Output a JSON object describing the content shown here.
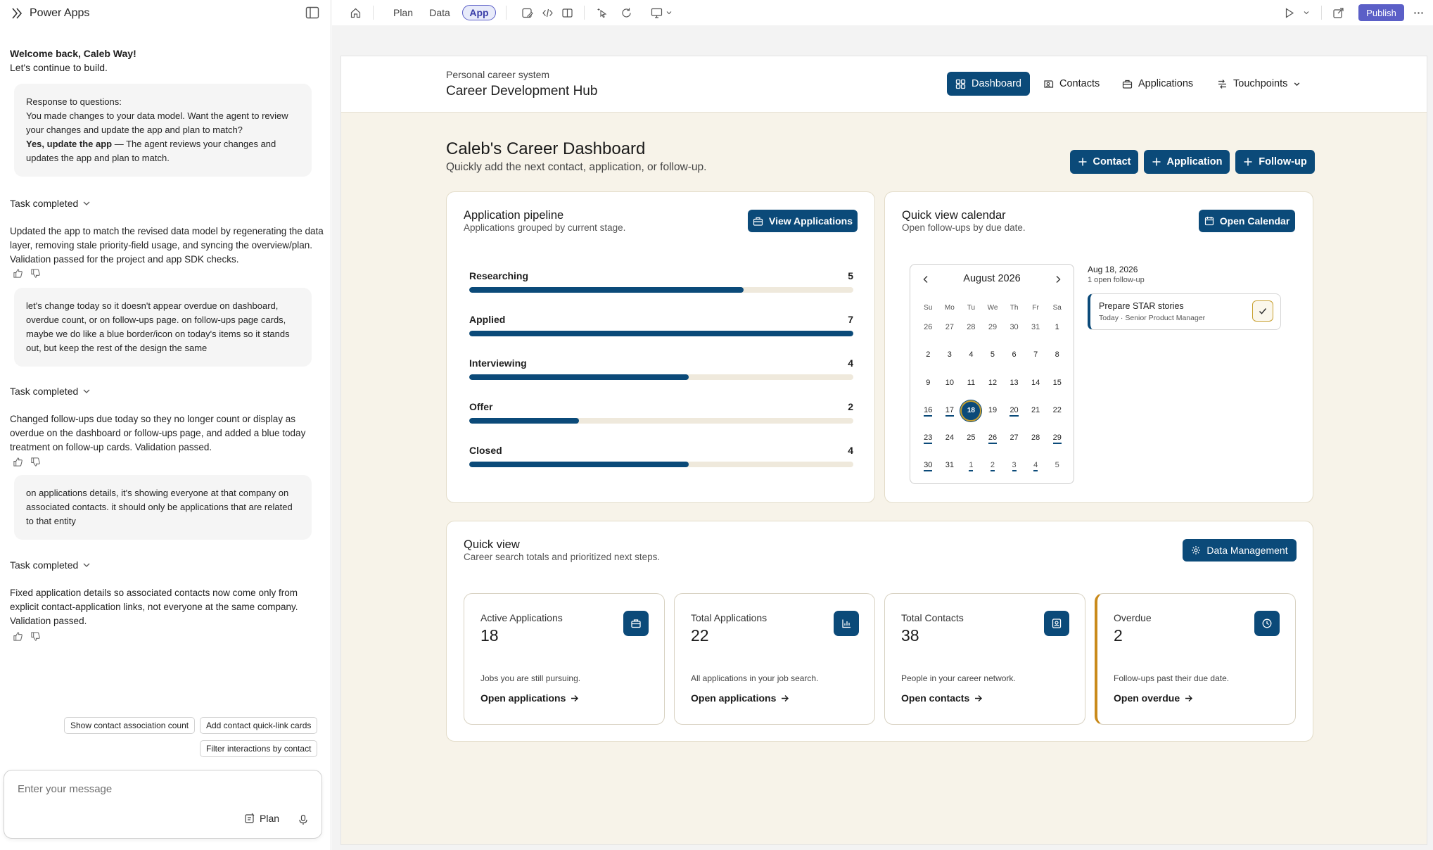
{
  "left_panel": {
    "brand": "Power Apps",
    "welcome_line1": "Welcome back, Caleb Way!",
    "welcome_line2": "Let's continue to build.",
    "response_bubble": {
      "heading": "Response to questions:",
      "body": "You made changes to your data model. Want the agent to review your changes and update the app and plan to match?",
      "choice_bold": "Yes, update the app",
      "choice_rest": " — The agent reviews your changes and updates the app and plan to match."
    },
    "task_completed_label": "Task completed",
    "messages": [
      "Updated the app to match the revised data model by regenerating the data layer, removing stale priority-field usage, and syncing the overview/plan. Validation passed for the project and app SDK checks.",
      "Changed follow-ups due today so they no longer count or display as overdue on the dashboard or follow-ups page, and added a blue today treatment on follow-up cards. Validation passed.",
      "Fixed application details so associated contacts now come only from explicit contact-application links, not everyone at the same company. Validation passed."
    ],
    "user_messages": [
      "let's change today so it doesn't appear overdue on dashboard, overdue count, or on follow-ups page. on follow-ups page cards, maybe we do like a blue border/icon on today's items so it stands out, but keep the rest of the design the same",
      "on applications details, it's showing everyone at that company on associated contacts. it should only be applications that are related to that entity"
    ],
    "suggestions": [
      "Show contact association count",
      "Add contact quick-link cards",
      "Filter interactions by contact"
    ],
    "composer_placeholder": "Enter your message",
    "plan_label": "Plan"
  },
  "topbar": {
    "tabs": [
      "Plan",
      "Data",
      "App"
    ],
    "active_tab": "App",
    "publish_label": "Publish"
  },
  "app": {
    "subtitle": "Personal career system",
    "title": "Career Development Hub",
    "nav": [
      "Dashboard",
      "Contacts",
      "Applications",
      "Touchpoints"
    ],
    "active_nav": "Dashboard",
    "dashboard_title": "Caleb's Career Dashboard",
    "dashboard_subtitle": "Quickly add the next contact, application, or follow-up.",
    "quick_add": [
      "Contact",
      "Application",
      "Follow-up"
    ]
  },
  "pipeline": {
    "title": "Application pipeline",
    "subtitle": "Applications grouped by current stage.",
    "button": "View Applications",
    "max": 7,
    "stages": [
      {
        "label": "Researching",
        "value": 5
      },
      {
        "label": "Applied",
        "value": 7
      },
      {
        "label": "Interviewing",
        "value": 4
      },
      {
        "label": "Offer",
        "value": 2
      },
      {
        "label": "Closed",
        "value": 4
      }
    ]
  },
  "calendar": {
    "title": "Quick view calendar",
    "subtitle": "Open follow-ups by due date.",
    "button": "Open Calendar",
    "month_label": "August 2026",
    "dow": [
      "Su",
      "Mo",
      "Tu",
      "We",
      "Th",
      "Fr",
      "Sa"
    ],
    "days": [
      [
        "26",
        "27",
        "28",
        "29",
        "30",
        "31",
        "1"
      ],
      [
        "2",
        "3",
        "4",
        "5",
        "6",
        "7",
        "8"
      ],
      [
        "9",
        "10",
        "11",
        "12",
        "13",
        "14",
        "15"
      ],
      [
        "16",
        "17",
        "18",
        "19",
        "20",
        "21",
        "22"
      ],
      [
        "23",
        "24",
        "25",
        "26",
        "27",
        "28",
        "29"
      ],
      [
        "30",
        "31",
        "1",
        "2",
        "3",
        "4",
        "5"
      ]
    ],
    "today": "18",
    "selected_date": "Aug 18, 2026",
    "open_count": "1 open follow-up",
    "followup_title": "Prepare STAR stories",
    "followup_sub": "Today · Senior Product Manager"
  },
  "quick_view": {
    "title": "Quick view",
    "subtitle": "Career search totals and prioritized next steps.",
    "button": "Data Management",
    "stats": [
      {
        "label": "Active Applications",
        "value": "18",
        "desc": "Jobs you are still pursuing.",
        "link": "Open applications",
        "icon": "briefcase-icon"
      },
      {
        "label": "Total Applications",
        "value": "22",
        "desc": "All applications in your job search.",
        "link": "Open applications",
        "icon": "bar-chart-icon"
      },
      {
        "label": "Total Contacts",
        "value": "38",
        "desc": "People in your career network.",
        "link": "Open contacts",
        "icon": "contact-card-icon"
      },
      {
        "label": "Overdue",
        "value": "2",
        "desc": "Follow-ups past their due date.",
        "link": "Open overdue",
        "icon": "clock-icon"
      }
    ]
  },
  "colors": {
    "primary": "#0b4a79",
    "accent": "#5b5fc7",
    "warning": "#c98a1b",
    "app_bg": "#f7f3e9"
  }
}
